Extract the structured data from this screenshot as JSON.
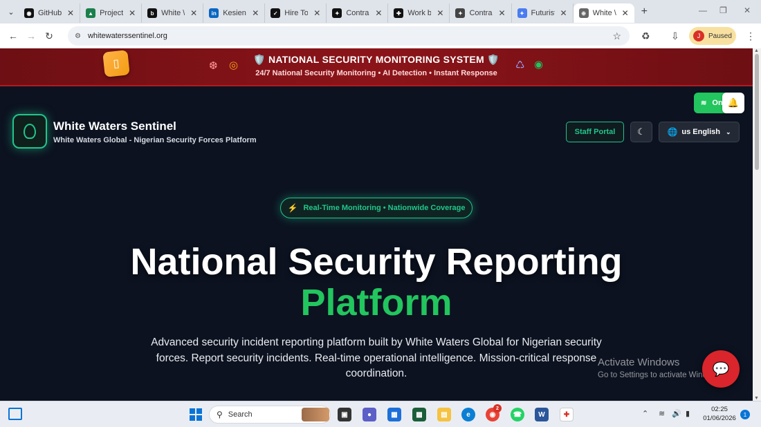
{
  "browser": {
    "tabs": [
      {
        "title": "GitHub",
        "icon": "github-icon",
        "color": "#111111"
      },
      {
        "title": "Project",
        "icon": "project-icon",
        "color": "#1a7f4b"
      },
      {
        "title": "White \\",
        "icon": "bootstrap-icon",
        "color": "#111111"
      },
      {
        "title": "Kesiena",
        "icon": "linkedin-icon",
        "color": "#0a66c2"
      },
      {
        "title": "Hire To",
        "icon": "upwork-icon",
        "color": "#111111"
      },
      {
        "title": "Contra",
        "icon": "contra-icon",
        "color": "#111111"
      },
      {
        "title": "Work b",
        "icon": "work-icon",
        "color": "#111111"
      },
      {
        "title": "Contra",
        "icon": "contra-icon",
        "color": "#444444"
      },
      {
        "title": "Futurist",
        "icon": "gemini-icon",
        "color": "#4a7cf0"
      },
      {
        "title": "White \\",
        "icon": "globe-icon",
        "color": "#666666"
      }
    ],
    "url": "whitewaterssentinel.org",
    "profile_initial": "J",
    "profile_status": "Paused"
  },
  "banner": {
    "title": "🛡️ NATIONAL SECURITY MONITORING SYSTEM 🛡️",
    "subtitle": "24/7 National Security Monitoring • AI Detection • Instant Response"
  },
  "header": {
    "brand": "White Waters Sentinel",
    "tagline": "White Waters Global - Nigerian Security Forces Platform",
    "staff_portal": "Staff Portal",
    "language": "us English",
    "online": "On"
  },
  "hero": {
    "badge": "Real-Time Monitoring • Nationwide Coverage",
    "title_line1": "National Security Reporting",
    "title_line2": "Platform",
    "description": "Advanced security incident reporting platform built by White Waters Global for Nigerian security forces. Report security incidents. Real-time operational intelligence. Mission-critical response coordination."
  },
  "watermark": {
    "line1": "Activate Windows",
    "line2": "Go to Settings to activate Windows."
  },
  "taskbar": {
    "search_placeholder": "Search",
    "time": "02:25",
    "date": "01/06/2026",
    "notification_count": "1",
    "chrome_badge": "2"
  },
  "colors": {
    "accent_green": "#22c55e",
    "banner_red": "#8b1419",
    "page_bg": "#0c1220"
  }
}
